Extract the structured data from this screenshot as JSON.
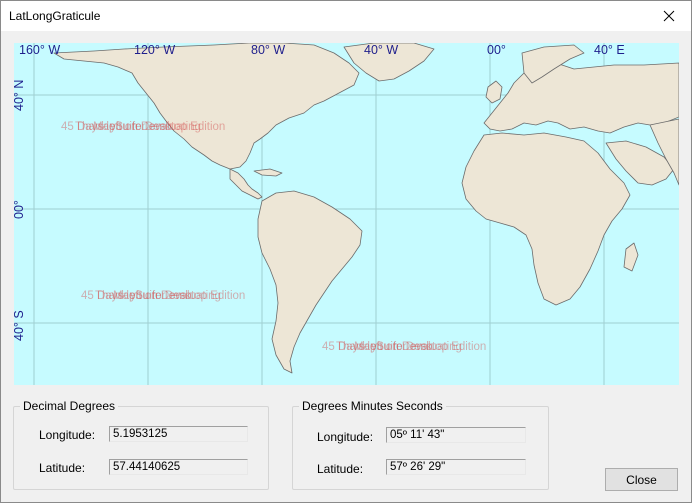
{
  "window": {
    "title": "LatLongGraticule",
    "close_icon": "close-icon"
  },
  "map": {
    "ocean_color": "#c6fbff",
    "land_color": "#ede6d6",
    "border_color": "#6b6b6b",
    "grid_color": "#9fcfd2",
    "label_color": "#1e1e8c",
    "lon_labels": [
      "160° W",
      "120° W",
      "80° W",
      "40° W",
      "00°",
      "40° E"
    ],
    "lat_labels": [
      "40° N",
      "00°",
      "40° S"
    ],
    "watermark_lines": [
      "45 Days left on Demo",
      "Thank you for evaluating",
      "MapSuite Desktop Edition"
    ]
  },
  "decimal": {
    "legend": "Decimal Degrees",
    "longitude_label": "Longitude:",
    "longitude_value": "5.1953125",
    "latitude_label": "Latitude:",
    "latitude_value": "57.44140625"
  },
  "dms": {
    "legend": "Degrees Minutes Seconds",
    "longitude_label": "Longitude:",
    "longitude_value": "05º 11' 43\"",
    "latitude_label": "Latitude:",
    "latitude_value": "57º 26' 29\""
  },
  "buttons": {
    "close_label": "Close"
  }
}
